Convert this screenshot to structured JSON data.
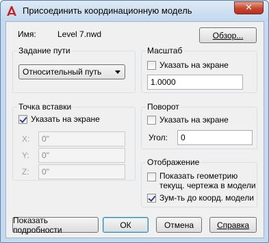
{
  "window": {
    "title": "Присоединить координационную модель",
    "close_glyph": "✕"
  },
  "name_row": {
    "label": "Имя:",
    "value": "Level 7.nwd",
    "browse_button": "Обзор..."
  },
  "path_group": {
    "title": "Задание пути",
    "selected": "Относительный путь"
  },
  "scale_group": {
    "title": "Масштаб",
    "onscreen_label": "Указать на экране",
    "onscreen_checked": false,
    "value": "1.0000"
  },
  "insert_group": {
    "title": "Точка вставки",
    "onscreen_label": "Указать на экране",
    "onscreen_checked": true,
    "x_label": "X:",
    "y_label": "Y:",
    "z_label": "Z:",
    "x_value": "0\"",
    "y_value": "0\"",
    "z_value": "0\""
  },
  "rotation_group": {
    "title": "Поворот",
    "onscreen_label": "Указать на экране",
    "onscreen_checked": false,
    "angle_label": "Угол:",
    "angle_value": "0"
  },
  "display_group": {
    "title": "Отображение",
    "show_geometry_line1": "Показать геометрию",
    "show_geometry_line2": "текущ. чертежа в модели",
    "show_geometry_checked": false,
    "zoom_label": "Зум-ть до коорд. модели",
    "zoom_checked": true
  },
  "buttons": {
    "details": "Показать подробности",
    "ok": "ОК",
    "cancel": "Отмена",
    "help": "Справка"
  },
  "colors": {
    "frame": "#c6daef",
    "close_red": "#c4452f",
    "logo_red": "#c8201e"
  }
}
